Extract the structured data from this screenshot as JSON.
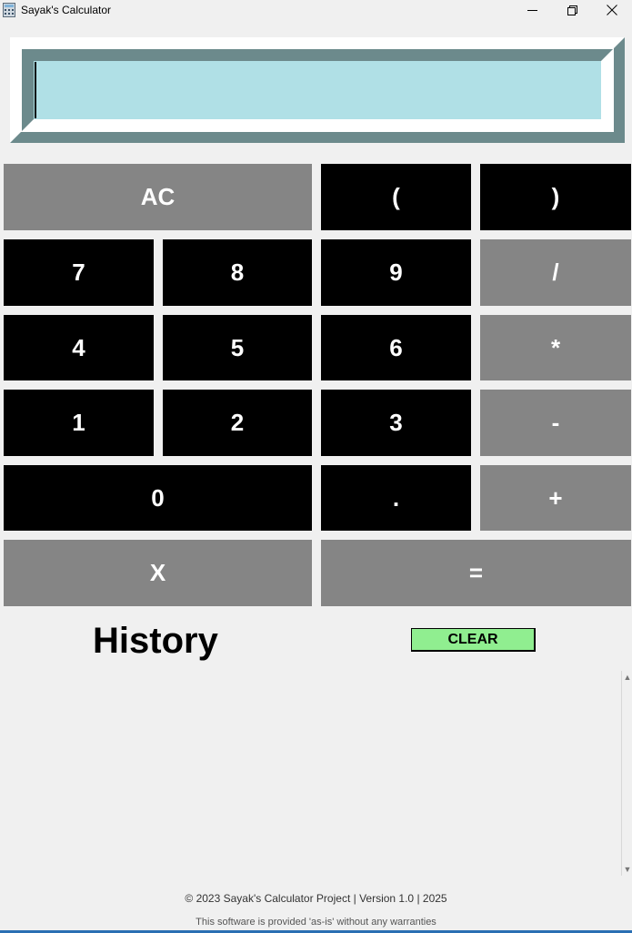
{
  "window": {
    "title": "Sayak's Calculator",
    "controls": {
      "minimize": "—",
      "maximize": "❐",
      "close": "✕"
    }
  },
  "display": {
    "value": "",
    "background": "#b0e0e6",
    "border_color": "#6c8a8c"
  },
  "keypad": {
    "colors": {
      "dark": "#000000",
      "gray": "#858585",
      "text": "#ffffff"
    },
    "keys": {
      "ac": "AC",
      "lparen": "(",
      "rparen": ")",
      "k7": "7",
      "k8": "8",
      "k9": "9",
      "div": "/",
      "k4": "4",
      "k5": "5",
      "k6": "6",
      "mul": "*",
      "k1": "1",
      "k2": "2",
      "k3": "3",
      "sub": "-",
      "k0": "0",
      "dot": ".",
      "add": "+",
      "backspace": "X",
      "equals": "="
    }
  },
  "history": {
    "title": "History",
    "clear_label": "CLEAR",
    "clear_color": "#90ee90",
    "entries": []
  },
  "footer": {
    "line1": "© 2023 Sayak's Calculator Project | Version 1.0 | 2025",
    "line2": "This software is provided 'as-is' without any warranties"
  }
}
